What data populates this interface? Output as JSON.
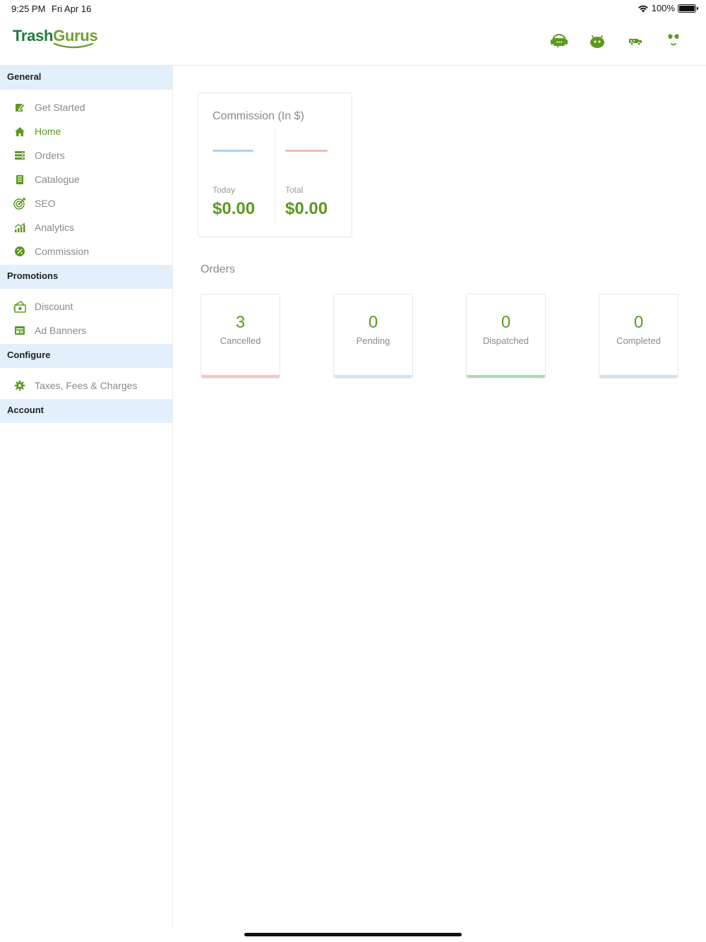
{
  "status_bar": {
    "time": "9:25 PM",
    "date": "Fri Apr 16",
    "battery": "100%"
  },
  "header": {
    "logo_part1": "Trash",
    "logo_part2": "Gurus",
    "icons": [
      "support-chat-icon",
      "android-icon",
      "delivery-truck-icon",
      "user-profile-icon"
    ],
    "accent_color": "#5c9a1f"
  },
  "sidebar": {
    "sections": [
      {
        "title": "General",
        "items": [
          {
            "label": "Get Started",
            "icon": "edit-icon"
          },
          {
            "label": "Home",
            "icon": "home-icon",
            "active": true
          },
          {
            "label": "Orders",
            "icon": "orders-icon"
          },
          {
            "label": "Catalogue",
            "icon": "book-icon"
          },
          {
            "label": "SEO",
            "icon": "target-icon"
          },
          {
            "label": "Analytics",
            "icon": "chart-icon"
          },
          {
            "label": "Commission",
            "icon": "percent-icon"
          }
        ]
      },
      {
        "title": "Promotions",
        "items": [
          {
            "label": "Discount",
            "icon": "discount-icon"
          },
          {
            "label": "Ad Banners",
            "icon": "banner-icon"
          }
        ]
      },
      {
        "title": "Configure",
        "items": [
          {
            "label": "Taxes, Fees & Charges",
            "icon": "gear-icon"
          }
        ]
      },
      {
        "title": "Account",
        "items": []
      }
    ]
  },
  "commission": {
    "title": "Commission (In $)",
    "today_label": "Today",
    "today_value": "$0.00",
    "total_label": "Total",
    "total_value": "$0.00",
    "today_color": "#a8d4f5",
    "total_color": "#f5b8b0"
  },
  "orders": {
    "title": "Orders",
    "cards": [
      {
        "count": "3",
        "label": "Cancelled",
        "color": "#f6c4bf"
      },
      {
        "count": "0",
        "label": "Pending",
        "color": "#cfe6f8"
      },
      {
        "count": "0",
        "label": "Dispatched",
        "color": "#a8dfa8"
      },
      {
        "count": "0",
        "label": "Completed",
        "color": "#d3dff3"
      }
    ]
  }
}
